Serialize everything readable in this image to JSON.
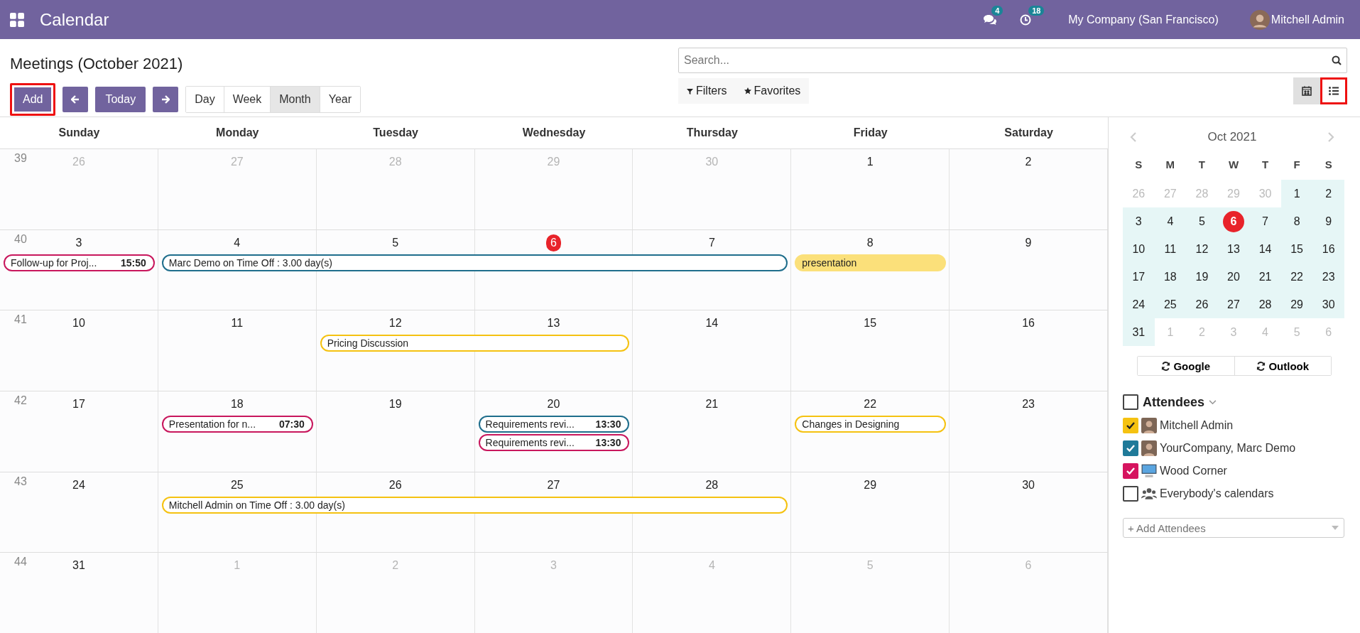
{
  "navbar": {
    "app_title": "Calendar",
    "messages_badge": "4",
    "activities_badge": "18",
    "company": "My Company (San Francisco)",
    "user": "Mitchell Admin"
  },
  "control_panel": {
    "title": "Meetings (October 2021)",
    "add_button": {
      "label": "Add",
      "highlighted": true
    },
    "today_button": "Today",
    "scales": [
      {
        "label": "Day",
        "selected": false
      },
      {
        "label": "Week",
        "selected": false
      },
      {
        "label": "Month",
        "selected": true
      },
      {
        "label": "Year",
        "selected": false
      }
    ],
    "search": {
      "placeholder": "Search..."
    },
    "filters": "Filters",
    "favorites": "Favorites",
    "views": [
      {
        "kind": "calendar",
        "selected": true,
        "highlighted": false
      },
      {
        "kind": "list",
        "selected": false,
        "highlighted": true
      }
    ]
  },
  "calendar": {
    "weekdays": [
      "Sunday",
      "Monday",
      "Tuesday",
      "Wednesday",
      "Thursday",
      "Friday",
      "Saturday"
    ],
    "weeks": [
      {
        "number": "39",
        "days": [
          {
            "label": "26",
            "in_month": false,
            "today": false
          },
          {
            "label": "27",
            "in_month": false,
            "today": false
          },
          {
            "label": "28",
            "in_month": false,
            "today": false
          },
          {
            "label": "29",
            "in_month": false,
            "today": false
          },
          {
            "label": "30",
            "in_month": false,
            "today": false
          },
          {
            "label": "1",
            "in_month": true,
            "today": false
          },
          {
            "label": "2",
            "in_month": true,
            "today": false
          }
        ]
      },
      {
        "number": "40",
        "days": [
          {
            "label": "3",
            "in_month": true,
            "today": false,
            "events": [
              {
                "kind": "outline",
                "title": "Follow-up for Proj...",
                "time": "15:50",
                "color": "#c8175d"
              }
            ]
          },
          {
            "label": "4",
            "in_month": true,
            "today": false,
            "events": [
              {
                "kind": "outline",
                "title": "Marc Demo on Time Off : 3.00 day(s)",
                "color": "#1f6e8c"
              }
            ]
          },
          {
            "label": "5",
            "in_month": true,
            "today": false,
            "events": [
              {
                "kind": "continued"
              }
            ]
          },
          {
            "label": "6",
            "in_month": true,
            "today": true,
            "events": [
              {
                "kind": "continued"
              }
            ]
          },
          {
            "label": "7",
            "in_month": true,
            "today": false,
            "events": [
              {
                "kind": "continued"
              }
            ]
          },
          {
            "label": "8",
            "in_month": true,
            "today": false,
            "events": [
              {
                "kind": "filled",
                "title": "presentation",
                "color": "#fbe07a"
              }
            ]
          },
          {
            "label": "9",
            "in_month": true,
            "today": false
          }
        ]
      },
      {
        "number": "41",
        "days": [
          {
            "label": "10",
            "in_month": true,
            "today": false
          },
          {
            "label": "11",
            "in_month": true,
            "today": false
          },
          {
            "label": "12",
            "in_month": true,
            "today": false,
            "events": [
              {
                "kind": "outline",
                "title": "Pricing Discussion",
                "color": "#f5c211"
              }
            ]
          },
          {
            "label": "13",
            "in_month": true,
            "today": false,
            "events": [
              {
                "kind": "continued"
              }
            ]
          },
          {
            "label": "14",
            "in_month": true,
            "today": false
          },
          {
            "label": "15",
            "in_month": true,
            "today": false
          },
          {
            "label": "16",
            "in_month": true,
            "today": false
          }
        ]
      },
      {
        "number": "42",
        "days": [
          {
            "label": "17",
            "in_month": true,
            "today": false
          },
          {
            "label": "18",
            "in_month": true,
            "today": false,
            "events": [
              {
                "kind": "outline",
                "title": "Presentation for n...",
                "time": "07:30",
                "color": "#c8175d"
              }
            ]
          },
          {
            "label": "19",
            "in_month": true,
            "today": false
          },
          {
            "label": "20",
            "in_month": true,
            "today": false,
            "events": [
              {
                "kind": "outline",
                "title": "Requirements revi...",
                "time": "13:30",
                "color": "#1f6e8c"
              },
              {
                "kind": "outline",
                "title": "Requirements revi...",
                "time": "13:30",
                "color": "#c8175d"
              }
            ]
          },
          {
            "label": "21",
            "in_month": true,
            "today": false
          },
          {
            "label": "22",
            "in_month": true,
            "today": false,
            "events": [
              {
                "kind": "outline",
                "title": "Changes in Designing",
                "color": "#f5c211"
              }
            ]
          },
          {
            "label": "23",
            "in_month": true,
            "today": false
          }
        ]
      },
      {
        "number": "43",
        "days": [
          {
            "label": "24",
            "in_month": true,
            "today": false
          },
          {
            "label": "25",
            "in_month": true,
            "today": false,
            "events": [
              {
                "kind": "outline",
                "title": "Mitchell Admin on Time Off : 3.00 day(s)",
                "color": "#f5c211"
              }
            ]
          },
          {
            "label": "26",
            "in_month": true,
            "today": false,
            "events": [
              {
                "kind": "continued"
              }
            ]
          },
          {
            "label": "27",
            "in_month": true,
            "today": false,
            "events": [
              {
                "kind": "continued"
              }
            ]
          },
          {
            "label": "28",
            "in_month": true,
            "today": false,
            "events": [
              {
                "kind": "continued"
              }
            ]
          },
          {
            "label": "29",
            "in_month": true,
            "today": false
          },
          {
            "label": "30",
            "in_month": true,
            "today": false
          }
        ]
      },
      {
        "number": "44",
        "days": [
          {
            "label": "31",
            "in_month": true,
            "today": false
          },
          {
            "label": "1",
            "in_month": false,
            "today": false
          },
          {
            "label": "2",
            "in_month": false,
            "today": false
          },
          {
            "label": "3",
            "in_month": false,
            "today": false
          },
          {
            "label": "4",
            "in_month": false,
            "today": false
          },
          {
            "label": "5",
            "in_month": false,
            "today": false
          },
          {
            "label": "6",
            "in_month": false,
            "today": false
          }
        ]
      }
    ]
  },
  "mini_calendar": {
    "title": "Oct 2021",
    "weekdays": [
      "S",
      "M",
      "T",
      "W",
      "T",
      "F",
      "S"
    ],
    "weeks": [
      [
        {
          "label": "26",
          "in_month": false,
          "today": false
        },
        {
          "label": "27",
          "in_month": false,
          "today": false
        },
        {
          "label": "28",
          "in_month": false,
          "today": false
        },
        {
          "label": "29",
          "in_month": false,
          "today": false
        },
        {
          "label": "30",
          "in_month": false,
          "today": false
        },
        {
          "label": "1",
          "in_month": true,
          "today": false
        },
        {
          "label": "2",
          "in_month": true,
          "today": false
        }
      ],
      [
        {
          "label": "3",
          "in_month": true,
          "today": false
        },
        {
          "label": "4",
          "in_month": true,
          "today": false
        },
        {
          "label": "5",
          "in_month": true,
          "today": false
        },
        {
          "label": "6",
          "in_month": true,
          "today": true
        },
        {
          "label": "7",
          "in_month": true,
          "today": false
        },
        {
          "label": "8",
          "in_month": true,
          "today": false
        },
        {
          "label": "9",
          "in_month": true,
          "today": false
        }
      ],
      [
        {
          "label": "10",
          "in_month": true,
          "today": false
        },
        {
          "label": "11",
          "in_month": true,
          "today": false
        },
        {
          "label": "12",
          "in_month": true,
          "today": false
        },
        {
          "label": "13",
          "in_month": true,
          "today": false
        },
        {
          "label": "14",
          "in_month": true,
          "today": false
        },
        {
          "label": "15",
          "in_month": true,
          "today": false
        },
        {
          "label": "16",
          "in_month": true,
          "today": false
        }
      ],
      [
        {
          "label": "17",
          "in_month": true,
          "today": false
        },
        {
          "label": "18",
          "in_month": true,
          "today": false
        },
        {
          "label": "19",
          "in_month": true,
          "today": false
        },
        {
          "label": "20",
          "in_month": true,
          "today": false
        },
        {
          "label": "21",
          "in_month": true,
          "today": false
        },
        {
          "label": "22",
          "in_month": true,
          "today": false
        },
        {
          "label": "23",
          "in_month": true,
          "today": false
        }
      ],
      [
        {
          "label": "24",
          "in_month": true,
          "today": false
        },
        {
          "label": "25",
          "in_month": true,
          "today": false
        },
        {
          "label": "26",
          "in_month": true,
          "today": false
        },
        {
          "label": "27",
          "in_month": true,
          "today": false
        },
        {
          "label": "28",
          "in_month": true,
          "today": false
        },
        {
          "label": "29",
          "in_month": true,
          "today": false
        },
        {
          "label": "30",
          "in_month": true,
          "today": false
        }
      ],
      [
        {
          "label": "31",
          "in_month": true,
          "today": false
        },
        {
          "label": "1",
          "in_month": false,
          "today": false
        },
        {
          "label": "2",
          "in_month": false,
          "today": false
        },
        {
          "label": "3",
          "in_month": false,
          "today": false
        },
        {
          "label": "4",
          "in_month": false,
          "today": false
        },
        {
          "label": "5",
          "in_month": false,
          "today": false
        },
        {
          "label": "6",
          "in_month": false,
          "today": false
        }
      ]
    ]
  },
  "sync_buttons": [
    "Google",
    "Outlook"
  ],
  "attendees": {
    "title": "Attendees",
    "checked": false,
    "items": [
      {
        "name": "Mitchell Admin",
        "checked": true,
        "color": "#f5c211",
        "kind": "photo"
      },
      {
        "name": "YourCompany, Marc Demo",
        "checked": true,
        "color": "#1f7a99",
        "kind": "photo"
      },
      {
        "name": "Wood Corner",
        "checked": true,
        "color": "#d6145f",
        "kind": "logo"
      },
      {
        "name": "Everybody's calendars",
        "checked": false,
        "kind": "group"
      }
    ],
    "add_placeholder": "+ Add Attendees"
  }
}
